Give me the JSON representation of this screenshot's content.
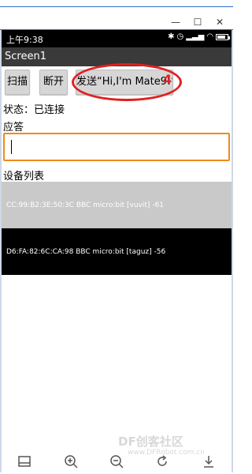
{
  "window": {
    "minimize": "—",
    "maximize": "☐",
    "close": "✕"
  },
  "statusbar": {
    "time": "上午9:38"
  },
  "app": {
    "title": "Screen1"
  },
  "buttons": {
    "scan": "扫描",
    "disconnect": "断开",
    "send": "发送“Hi,I'm Mate9!”"
  },
  "annotation": {
    "number": "4",
    "color": "#e02020"
  },
  "status": {
    "text": "状态：已连接"
  },
  "response": {
    "label": "应答",
    "value": ""
  },
  "devices": {
    "label": "设备列表",
    "items": [
      "CC:99:B2:3E:50:3C BBC micro:bit [vuvit] -61",
      "D6:FA:82:6C:CA:98 BBC micro:bit [taguz] -56"
    ]
  },
  "watermark": {
    "main": "DF创客社区",
    "sub": "www.DFRobot.com.cn"
  },
  "toolbar": {
    "icons": [
      "page-icon",
      "zoom-in-icon",
      "zoom-out-icon",
      "rotate-icon",
      "download-icon"
    ]
  },
  "colors": {
    "accent": "#f08a1a",
    "appbar": "#3a3a3a",
    "row_selected": "#c9c9c9"
  }
}
